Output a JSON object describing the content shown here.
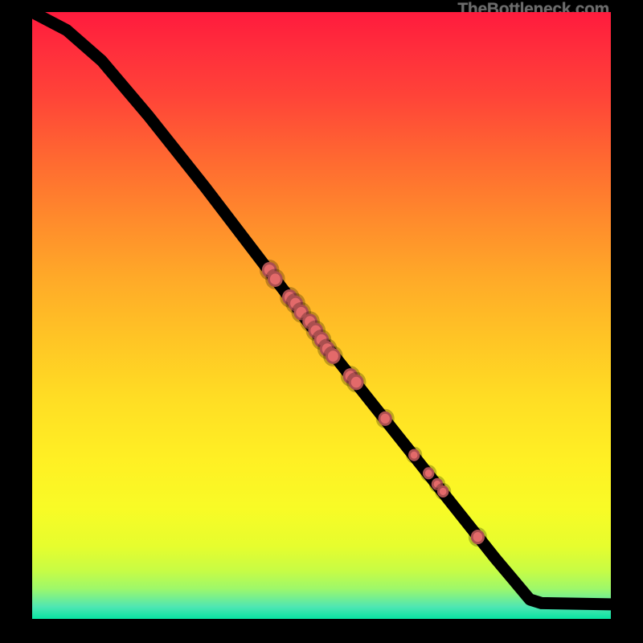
{
  "watermark": "TheBottleneck.com",
  "chart_data": {
    "type": "line",
    "title": "",
    "xlabel": "",
    "ylabel": "",
    "xlim": [
      0,
      100
    ],
    "ylim": [
      0,
      100
    ],
    "line": [
      {
        "x": 0,
        "y": 100
      },
      {
        "x": 6,
        "y": 97
      },
      {
        "x": 12,
        "y": 92
      },
      {
        "x": 20,
        "y": 83
      },
      {
        "x": 30,
        "y": 71
      },
      {
        "x": 40,
        "y": 58.5
      },
      {
        "x": 50,
        "y": 46
      },
      {
        "x": 60,
        "y": 34
      },
      {
        "x": 70,
        "y": 22
      },
      {
        "x": 80,
        "y": 10
      },
      {
        "x": 86,
        "y": 3.2
      },
      {
        "x": 88,
        "y": 2.6
      },
      {
        "x": 100,
        "y": 2.4
      }
    ],
    "points": [
      {
        "x": 41,
        "y": 57.5,
        "r": 1.3
      },
      {
        "x": 42,
        "y": 56,
        "r": 1.3
      },
      {
        "x": 44.5,
        "y": 53,
        "r": 1.3
      },
      {
        "x": 45.5,
        "y": 52,
        "r": 1.3
      },
      {
        "x": 46.5,
        "y": 50.5,
        "r": 1.3
      },
      {
        "x": 48,
        "y": 49,
        "r": 1.3
      },
      {
        "x": 49,
        "y": 47.5,
        "r": 1.3
      },
      {
        "x": 50,
        "y": 46,
        "r": 1.3
      },
      {
        "x": 51,
        "y": 44.5,
        "r": 1.3
      },
      {
        "x": 52,
        "y": 43.3,
        "r": 1.3
      },
      {
        "x": 55,
        "y": 40,
        "r": 1.3
      },
      {
        "x": 56,
        "y": 39,
        "r": 1.3
      },
      {
        "x": 61,
        "y": 33,
        "r": 1.2
      },
      {
        "x": 66,
        "y": 27,
        "r": 1.0
      },
      {
        "x": 68.5,
        "y": 24,
        "r": 1.0
      },
      {
        "x": 70,
        "y": 22.2,
        "r": 1.0
      },
      {
        "x": 71,
        "y": 21,
        "r": 1.0
      },
      {
        "x": 77,
        "y": 13.5,
        "r": 1.2
      }
    ]
  }
}
